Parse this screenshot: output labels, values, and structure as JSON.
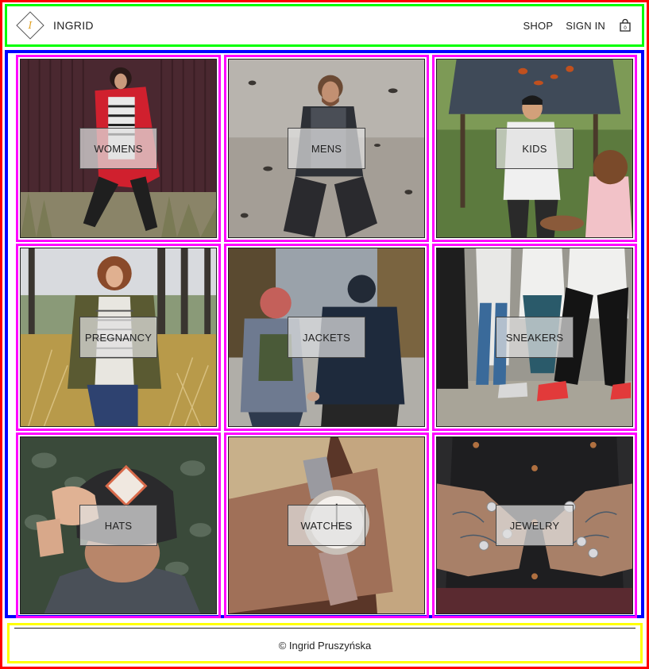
{
  "header": {
    "brand": "INGRID",
    "nav": {
      "shop": "SHOP",
      "sign_in": "SIGN IN"
    },
    "cart_count": "0"
  },
  "categories": [
    {
      "label": "WOMENS",
      "icon": "photo-woman-red-parka"
    },
    {
      "label": "MENS",
      "icon": "photo-man-kneeling-beach"
    },
    {
      "label": "KIDS",
      "icon": "photo-kids-treehouse-leaves"
    },
    {
      "label": "PREGNANCY",
      "icon": "photo-pregnant-woman-field"
    },
    {
      "label": "JACKETS",
      "icon": "photo-couple-holding-hands"
    },
    {
      "label": "SNEAKERS",
      "icon": "photo-dancing-crowd-sneakers"
    },
    {
      "label": "HATS",
      "icon": "photo-cap-back-of-head"
    },
    {
      "label": "WATCHES",
      "icon": "photo-wristwatch"
    },
    {
      "label": "JEWELRY",
      "icon": "photo-tattooed-hands-rings"
    }
  ],
  "footer": {
    "text": "© Ingrid Pruszyńska"
  },
  "colors": {
    "outer_frame": "#ff0000",
    "header_frame": "#00ff00",
    "grid_frame": "#0000ff",
    "tile_frame": "#ff00ff",
    "footer_frame": "#ffff00"
  }
}
